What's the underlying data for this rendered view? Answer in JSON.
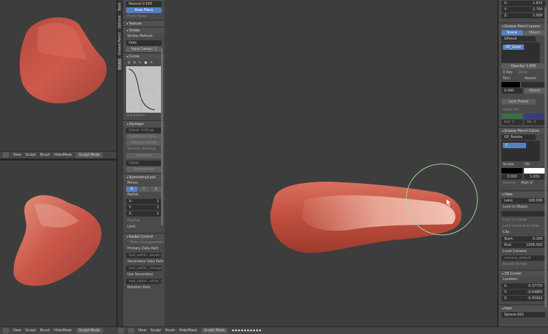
{
  "header_left": {
    "menus": [
      "View",
      "Sculpt",
      "Brush",
      "Hide/Mask"
    ],
    "mode": "Sculpt Mode"
  },
  "toolshelf": {
    "tabs": [
      "Tools",
      "Options",
      "Grease Pencil",
      "Sculpt"
    ],
    "top_fields": [
      "Normal",
      "0.500",
      "Area Plane",
      "Front Faces"
    ],
    "texture_title": "Texture",
    "stroke_title": "Stroke",
    "stroke_method_label": "Stroke Method:",
    "stroke_method": "Dots",
    "input_samples": "Input Sampl: 1",
    "curve_title": "Curve",
    "dyntopo_title": "Dyntopo",
    "dyntopo_detail": "Detail: 4.00 px",
    "dyntopo_subdiv": "Subdivide Colla...",
    "dyntopo_relative": "Relative Detail",
    "dyntopo_smooth": "Smooth Shading",
    "dyntopo_optimize": "Optimize",
    "dyntopo_detail2": "Detail",
    "dyntopo_symmetrize": "Symmetrize",
    "symmetry_title": "Symmetry/Lock",
    "mirror_label": "Mirror:",
    "mirror_buttons": [
      "X",
      "Y",
      "Z"
    ],
    "radial_label": "Radial:",
    "radial": [
      {
        "axis": "X:",
        "value": "1"
      },
      {
        "axis": "Y:",
        "value": "1"
      },
      {
        "axis": "Z:",
        "value": "1"
      }
    ],
    "feather_label": "Feather",
    "lock_label": "Lock:",
    "radial_control_title": "Radial Control",
    "radial_control_note": "* Redo Unsupported *",
    "primary_label": "Primary Data Path",
    "primary_value": "tool_settin...brush.size",
    "secondary_label": "Secondary Data Path",
    "secondary_value": "tool_settin...llmage.size",
    "use_secondary": "Use Secondary",
    "use_secondary_value": "tool_settin...sttler_size",
    "rotation_label": "Rotation Path"
  },
  "properties": {
    "xyz_top": [
      {
        "axis": "X:",
        "value": "1.872"
      },
      {
        "axis": "Y:",
        "value": "2.750"
      },
      {
        "axis": "Z:",
        "value": "1.009"
      }
    ],
    "gp_layers_title": "Grease Pencil Layers",
    "scene_tab": "Scene",
    "object_tab": "Object",
    "gp_name": "GPencil",
    "layer_name": "GP_Layer",
    "opacity": "Opacity: 1.000",
    "xray": "X Ray",
    "show": "Show",
    "tint_label": "Tint:",
    "parent_label": "Parent:",
    "tint_value": "0.000",
    "parent_value": "Object",
    "lock_frame": "Lock Frame",
    "onion_skin": "Onion Ski...",
    "before": "Bef: 0",
    "after": "Aft: 0",
    "gp_colors_title": "Grease Pencil Colors",
    "palette_name": "GP_Palette",
    "color_name": "C",
    "stroke_label": "Stroke:",
    "fill_label": "Fill:",
    "stroke_value": "0.000",
    "fill_value": "1.000",
    "volume": "Volume",
    "high_q": "High Q",
    "view_title": "View",
    "lens": "Lens:",
    "lens_value": "100.000",
    "lock_to_object": "Lock to Object:",
    "lock_to_cursor": "Lock to Cursor",
    "lock_camera": "Lock Camera to View",
    "clip_label": "Clip:",
    "clip_start": "Start:",
    "clip_start_value": "0.100",
    "clip_end": "End:",
    "clip_end_value": "1000.000",
    "local_camera": "Local Camera:",
    "camera_default": "camera_default",
    "render_border": "Render Border",
    "cursor_title": "3D Cursor",
    "location_label": "Location:",
    "cursor": [
      {
        "axis": "X:",
        "value": "0.37770"
      },
      {
        "axis": "Y:",
        "value": "-0.64865"
      },
      {
        "axis": "Z:",
        "value": "-0.35932"
      }
    ],
    "item_title": "Item",
    "item_value": "Sphere.001"
  },
  "colors": {
    "mesh": "#c9564a",
    "mesh_light": "#e89a8c",
    "accent": "#5680c2",
    "brush_circle": "#9fd99a"
  }
}
